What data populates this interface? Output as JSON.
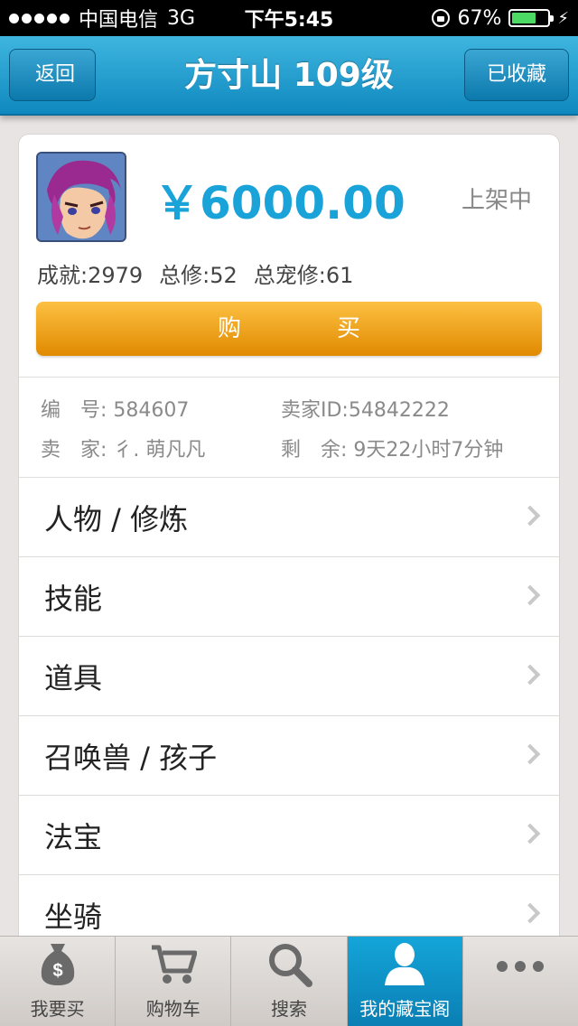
{
  "status_bar": {
    "carrier": "中国电信",
    "network": "3G",
    "time": "下午5:45",
    "battery_percent": "67%",
    "battery_level": 0.67
  },
  "nav": {
    "back_label": "返回",
    "title": "方寸山 109级",
    "fav_label": "已收藏"
  },
  "item": {
    "price": "￥6000.00",
    "listing_status": "上架中",
    "stats": {
      "achievement": "成就:2979",
      "total_cultivation": "总修:52",
      "pet_cultivation": "总宠修:61"
    },
    "buy_label": "购　买",
    "info": {
      "serial": "编　号: 584607",
      "seller_id": "卖家ID:54842222",
      "seller": "卖　家: 彳. 萌凡凡",
      "remaining": "剩　余: 9天22小时7分钟"
    }
  },
  "menu": [
    {
      "label": "人物 / 修炼"
    },
    {
      "label": "技能"
    },
    {
      "label": "道具"
    },
    {
      "label": "召唤兽 / 孩子"
    },
    {
      "label": "法宝"
    },
    {
      "label": "坐骑"
    }
  ],
  "tabs": [
    {
      "label": "我要买",
      "icon": "money-bag-icon"
    },
    {
      "label": "购物车",
      "icon": "cart-icon"
    },
    {
      "label": "搜索",
      "icon": "search-icon"
    },
    {
      "label": "我的藏宝阁",
      "icon": "user-icon",
      "active": true
    },
    {
      "label": "",
      "icon": "more-icon"
    }
  ],
  "colors": {
    "accent": "#1aa3d8",
    "buy_button": "#f5a623",
    "nav": "#1a95c9"
  }
}
